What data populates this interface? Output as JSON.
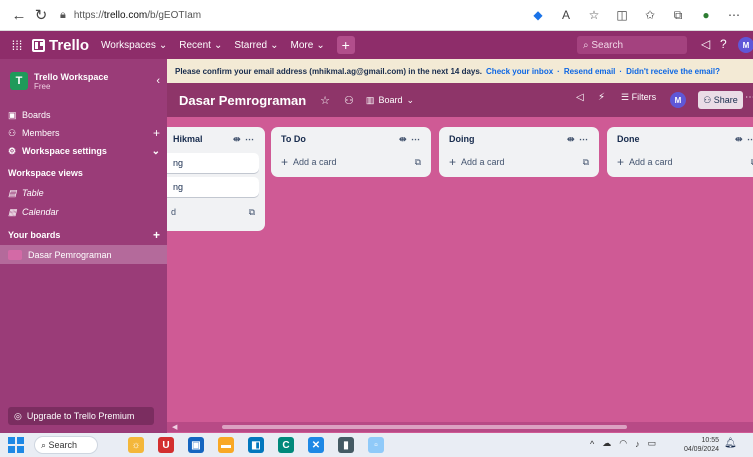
{
  "browser": {
    "url_prefix": "https://",
    "url_host": "trello.com",
    "url_path": "/b/gEOTIam"
  },
  "header": {
    "app_name": "Trello",
    "menus": [
      "Workspaces",
      "Recent",
      "Starred",
      "More"
    ],
    "search_placeholder": "Search",
    "avatar_initial": "M"
  },
  "sidebar": {
    "workspace_initial": "T",
    "workspace_name": "Trello Workspace",
    "workspace_plan": "Free",
    "items": [
      {
        "label": "Boards"
      },
      {
        "label": "Members"
      },
      {
        "label": "Workspace settings"
      }
    ],
    "views_title": "Workspace views",
    "views": [
      {
        "label": "Table"
      },
      {
        "label": "Calendar"
      }
    ],
    "boards_title": "Your boards",
    "boards": [
      {
        "label": "Dasar Pemrograman"
      }
    ],
    "upgrade_label": "Upgrade to Trello Premium"
  },
  "notice": {
    "text": "Please confirm your email address (mhikmal.ag@gmail.com) in the next 14 days.",
    "check_inbox": "Check your inbox",
    "resend": "Resend email",
    "didnt_receive": "Didn't receive the email?",
    "separator": "·"
  },
  "board": {
    "title": "Dasar Pemrograman",
    "view_label": "Board",
    "filters_label": "Filters",
    "share_label": "Share",
    "avatar_initial": "M"
  },
  "lists": [
    {
      "title": "Hikmal",
      "cards": [
        "ng",
        "ng"
      ],
      "add_label": "d"
    },
    {
      "title": "To Do",
      "cards": [],
      "add_label": "Add a card"
    },
    {
      "title": "Doing",
      "cards": [],
      "add_label": "Add a card"
    },
    {
      "title": "Done",
      "cards": [],
      "add_label": "Add a card"
    }
  ],
  "taskbar": {
    "search_label": "Search",
    "time": "10:55",
    "date": "04/09/2024"
  },
  "colors": {
    "header": "#8e2d6a",
    "sidebar": "#9a3c78",
    "canvas": "#cf5a95",
    "notice": "#f3ead5",
    "link": "#0c66e4"
  }
}
